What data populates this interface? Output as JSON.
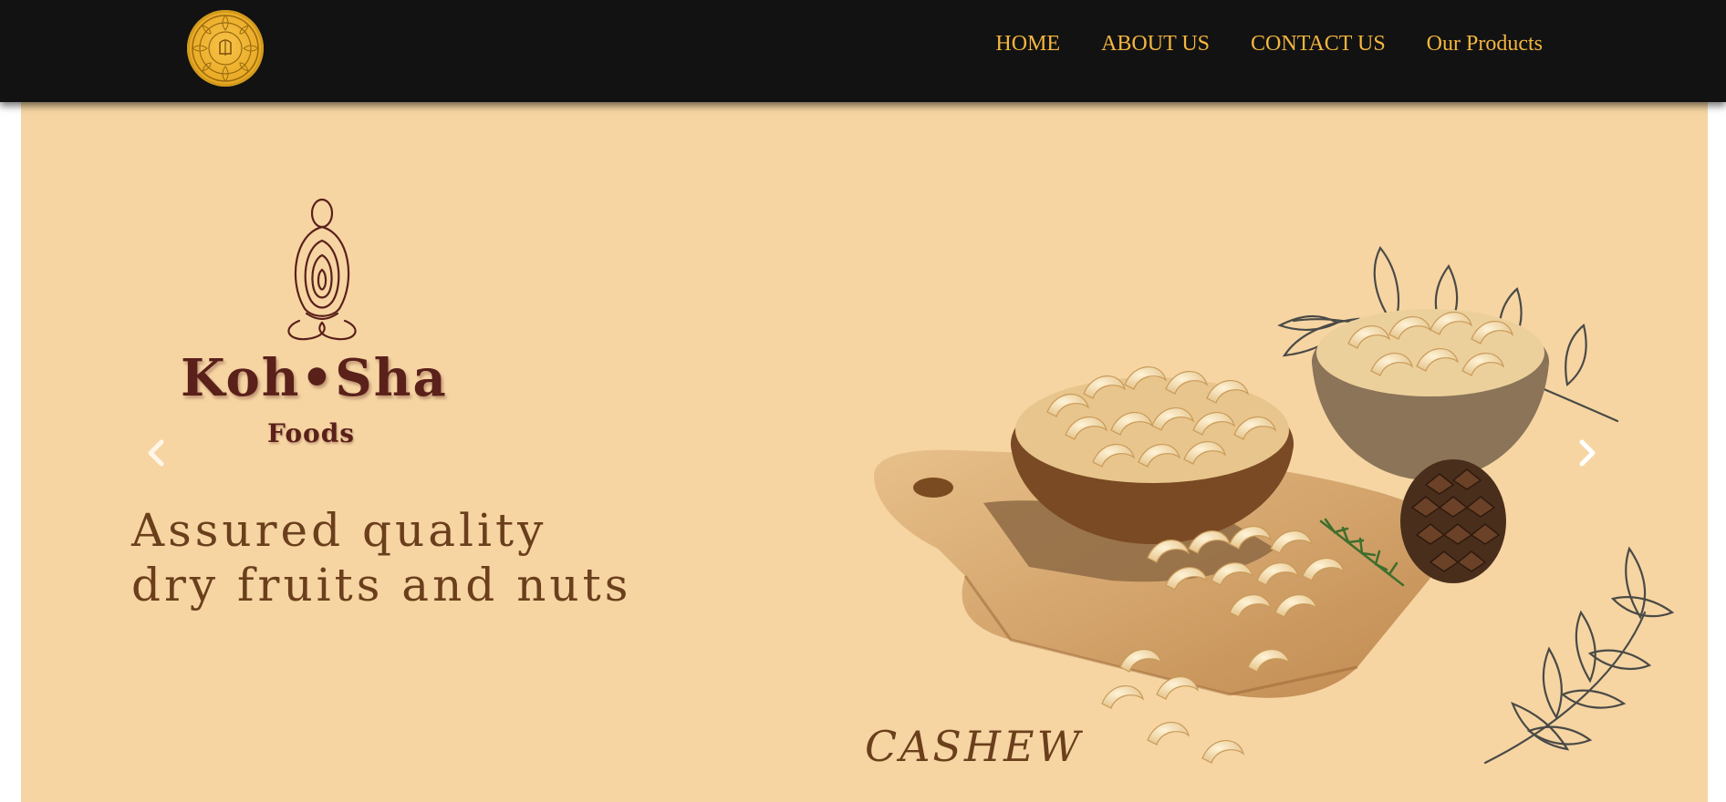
{
  "header": {
    "logo_icon": "mandala-emblem-icon",
    "nav": [
      {
        "label": "HOME"
      },
      {
        "label": "ABOUT US"
      },
      {
        "label": "CONTACT US"
      },
      {
        "label": "Our Products"
      }
    ]
  },
  "hero": {
    "brand_name": "Koh•Sha",
    "brand_sub": "Foods",
    "tagline_line1": "Assured quality",
    "tagline_line2": "dry fruits and nuts",
    "product_label": "CASHEW",
    "prev_icon": "chevron-left-icon",
    "next_icon": "chevron-right-icon"
  },
  "colors": {
    "nav_bg": "#121212",
    "nav_link": "#f4b63f",
    "hero_bg": "#f6d5a3",
    "brand": "#5a201a",
    "text_brown": "#6b3f1c"
  }
}
